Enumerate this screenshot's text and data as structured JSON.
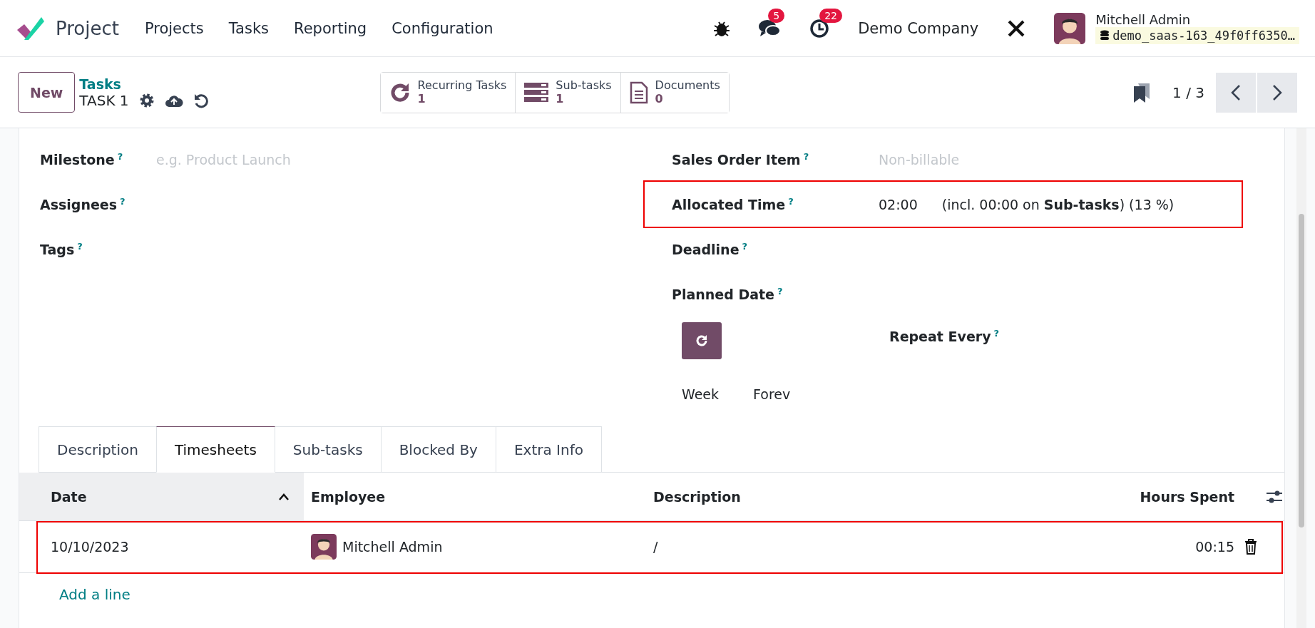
{
  "navbar": {
    "app_name": "Project",
    "menu": [
      "Projects",
      "Tasks",
      "Reporting",
      "Configuration"
    ],
    "messages_badge": "5",
    "activities_badge": "22",
    "company": "Demo Company",
    "user": {
      "name": "Mitchell Admin",
      "database": "demo_saas-163_49f0ff6350…"
    }
  },
  "control_panel": {
    "new_button": "New",
    "breadcrumb": "Tasks",
    "record_name": "TASK 1",
    "smart_buttons": [
      {
        "kind": "recurring",
        "label": "Recurring Tasks",
        "count": "1"
      },
      {
        "kind": "subtasks",
        "label": "Sub-tasks",
        "count": "1"
      },
      {
        "kind": "documents",
        "label": "Documents",
        "count": "0"
      }
    ],
    "pager": "1 / 3"
  },
  "form": {
    "left_fields": [
      {
        "label": "Milestone",
        "help": "?",
        "placeholder": "e.g. Product Launch"
      },
      {
        "label": "Assignees",
        "help": "?"
      },
      {
        "label": "Tags",
        "help": "?"
      }
    ],
    "right_fields": [
      {
        "label": "Sales Order Item",
        "help": "?",
        "placeholder": "Non-billable",
        "highlighted": false
      },
      {
        "label": "Allocated Time",
        "help": "?",
        "value": "02:00",
        "note": "(incl. 00:00 on **Sub-tasks**) (13 %)",
        "highlighted": true
      },
      {
        "label": "Deadline",
        "help": "?",
        "highlighted": false
      },
      {
        "label": "Planned Date",
        "help": "?",
        "highlighted": false
      }
    ],
    "recurrence": {
      "repeat_label": "Repeat Every",
      "help": "?",
      "unit": "Week",
      "until": "Forev"
    }
  },
  "tabs": [
    {
      "label": "Description",
      "selected": false
    },
    {
      "label": "Timesheets",
      "selected": true
    },
    {
      "label": "Sub-tasks",
      "selected": false
    },
    {
      "label": "Blocked By",
      "selected": false
    },
    {
      "label": "Extra Info",
      "selected": false
    }
  ],
  "timesheets": {
    "columns": [
      {
        "label": "Date",
        "sorted": true
      },
      {
        "label": "Employee",
        "sorted": false
      },
      {
        "label": "Description",
        "sorted": false
      },
      {
        "label": "Hours Spent",
        "sorted": false
      }
    ],
    "rows": [
      {
        "date": "10/10/2023",
        "employee": "Mitchell Admin",
        "description": "/",
        "hours": "00:15",
        "highlighted": true
      }
    ],
    "add_line": "Add a line"
  }
}
